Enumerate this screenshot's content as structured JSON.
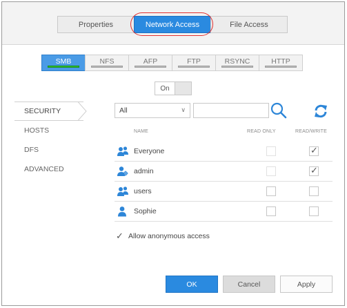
{
  "top_tabs": [
    {
      "label": "Properties",
      "active": false
    },
    {
      "label": "Network Access",
      "active": true
    },
    {
      "label": "File Access",
      "active": false
    }
  ],
  "protocols": [
    {
      "label": "SMB",
      "enabled": true
    },
    {
      "label": "NFS",
      "enabled": false
    },
    {
      "label": "AFP",
      "enabled": false
    },
    {
      "label": "FTP",
      "enabled": false
    },
    {
      "label": "RSYNC",
      "enabled": false
    },
    {
      "label": "HTTP",
      "enabled": false
    }
  ],
  "toggle": {
    "label": "On"
  },
  "sidebar": {
    "items": [
      {
        "label": "SECURITY",
        "active": true
      },
      {
        "label": "HOSTS",
        "active": false
      },
      {
        "label": "DFS",
        "active": false
      },
      {
        "label": "ADVANCED",
        "active": false
      }
    ]
  },
  "filter": {
    "selected": "All",
    "search_value": ""
  },
  "table": {
    "headers": {
      "name": "NAME",
      "read_only": "READ ONLY",
      "read_write": "READ/WRITE"
    },
    "rows": [
      {
        "name": "Everyone",
        "icon": "group-icon",
        "read_only": false,
        "read_write": true
      },
      {
        "name": "admin",
        "icon": "admin-user-icon",
        "read_only": false,
        "read_write": true
      },
      {
        "name": "users",
        "icon": "group-icon",
        "read_only": false,
        "read_write": false
      },
      {
        "name": "Sophie",
        "icon": "user-icon",
        "read_only": false,
        "read_write": false
      }
    ]
  },
  "anonymous": {
    "label": "Allow anonymous access",
    "checked": true
  },
  "buttons": {
    "ok": "OK",
    "cancel": "Cancel",
    "apply": "Apply"
  },
  "colors": {
    "accent": "#2a8ae0",
    "enabled_bar": "#2fc52f",
    "highlight": "#e03030",
    "icon_blue": "#2d86d8"
  }
}
